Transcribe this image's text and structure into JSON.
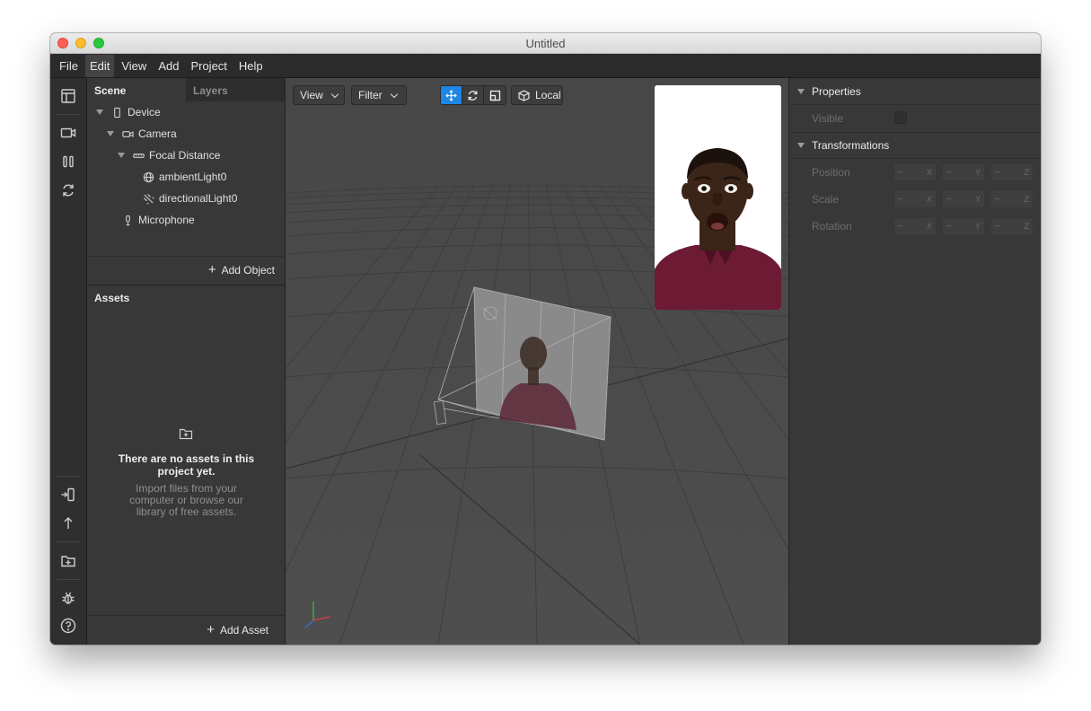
{
  "window": {
    "title": "Untitled"
  },
  "menu": [
    "File",
    "Edit",
    "View",
    "Add",
    "Project",
    "Help"
  ],
  "toolstrip": {
    "top_icons": [
      "layout-icon",
      "video-icon",
      "pause-bars-icon",
      "sync-icon"
    ],
    "bottom_icons": [
      "import-device-icon",
      "upload-arrow-icon",
      "add-folder-icon",
      "bug-icon",
      "help-icon"
    ]
  },
  "scene_panel": {
    "tabs": [
      "Scene",
      "Layers"
    ],
    "tree": [
      {
        "label": "Device",
        "icon": "phone-icon",
        "expanded": true
      },
      {
        "label": "Camera",
        "icon": "camera-icon",
        "expanded": true
      },
      {
        "label": "Focal Distance",
        "icon": "ruler-icon",
        "expanded": true
      },
      {
        "label": "ambientLight0",
        "icon": "globe-light-icon"
      },
      {
        "label": "directionalLight0",
        "icon": "directional-light-icon"
      },
      {
        "label": "Microphone",
        "icon": "microphone-icon"
      }
    ],
    "add_object_label": "Add Object"
  },
  "assets_panel": {
    "title": "Assets",
    "empty_title": "There are no assets in this project yet.",
    "empty_subtitle": "Import files from your computer or browse our library of free assets.",
    "add_asset_label": "Add Asset"
  },
  "viewport": {
    "view_label": "View",
    "filter_label": "Filter",
    "transform_tools": [
      "move-icon",
      "rotate-icon",
      "scale-icon"
    ],
    "active_tool": "move-icon",
    "space_label": "Local"
  },
  "properties": {
    "section_title": "Properties",
    "visible_label": "Visible",
    "visible": false
  },
  "transformations": {
    "section_title": "Transformations",
    "rows": [
      {
        "label": "Position",
        "values": [
          "–",
          "–",
          "–"
        ],
        "axes": [
          "X",
          "Y",
          "Z"
        ]
      },
      {
        "label": "Scale",
        "values": [
          "–",
          "–",
          "–"
        ],
        "axes": [
          "X",
          "Y",
          "Z"
        ]
      },
      {
        "label": "Rotation",
        "values": [
          "–",
          "–",
          "–"
        ],
        "axes": [
          "X",
          "Y",
          "Z"
        ]
      }
    ]
  },
  "colors": {
    "accent": "#1d86e6",
    "panel": "#383838",
    "viewport": "#4c4c4c",
    "shirt": "#6d1b34",
    "skin": "#3b2418"
  }
}
